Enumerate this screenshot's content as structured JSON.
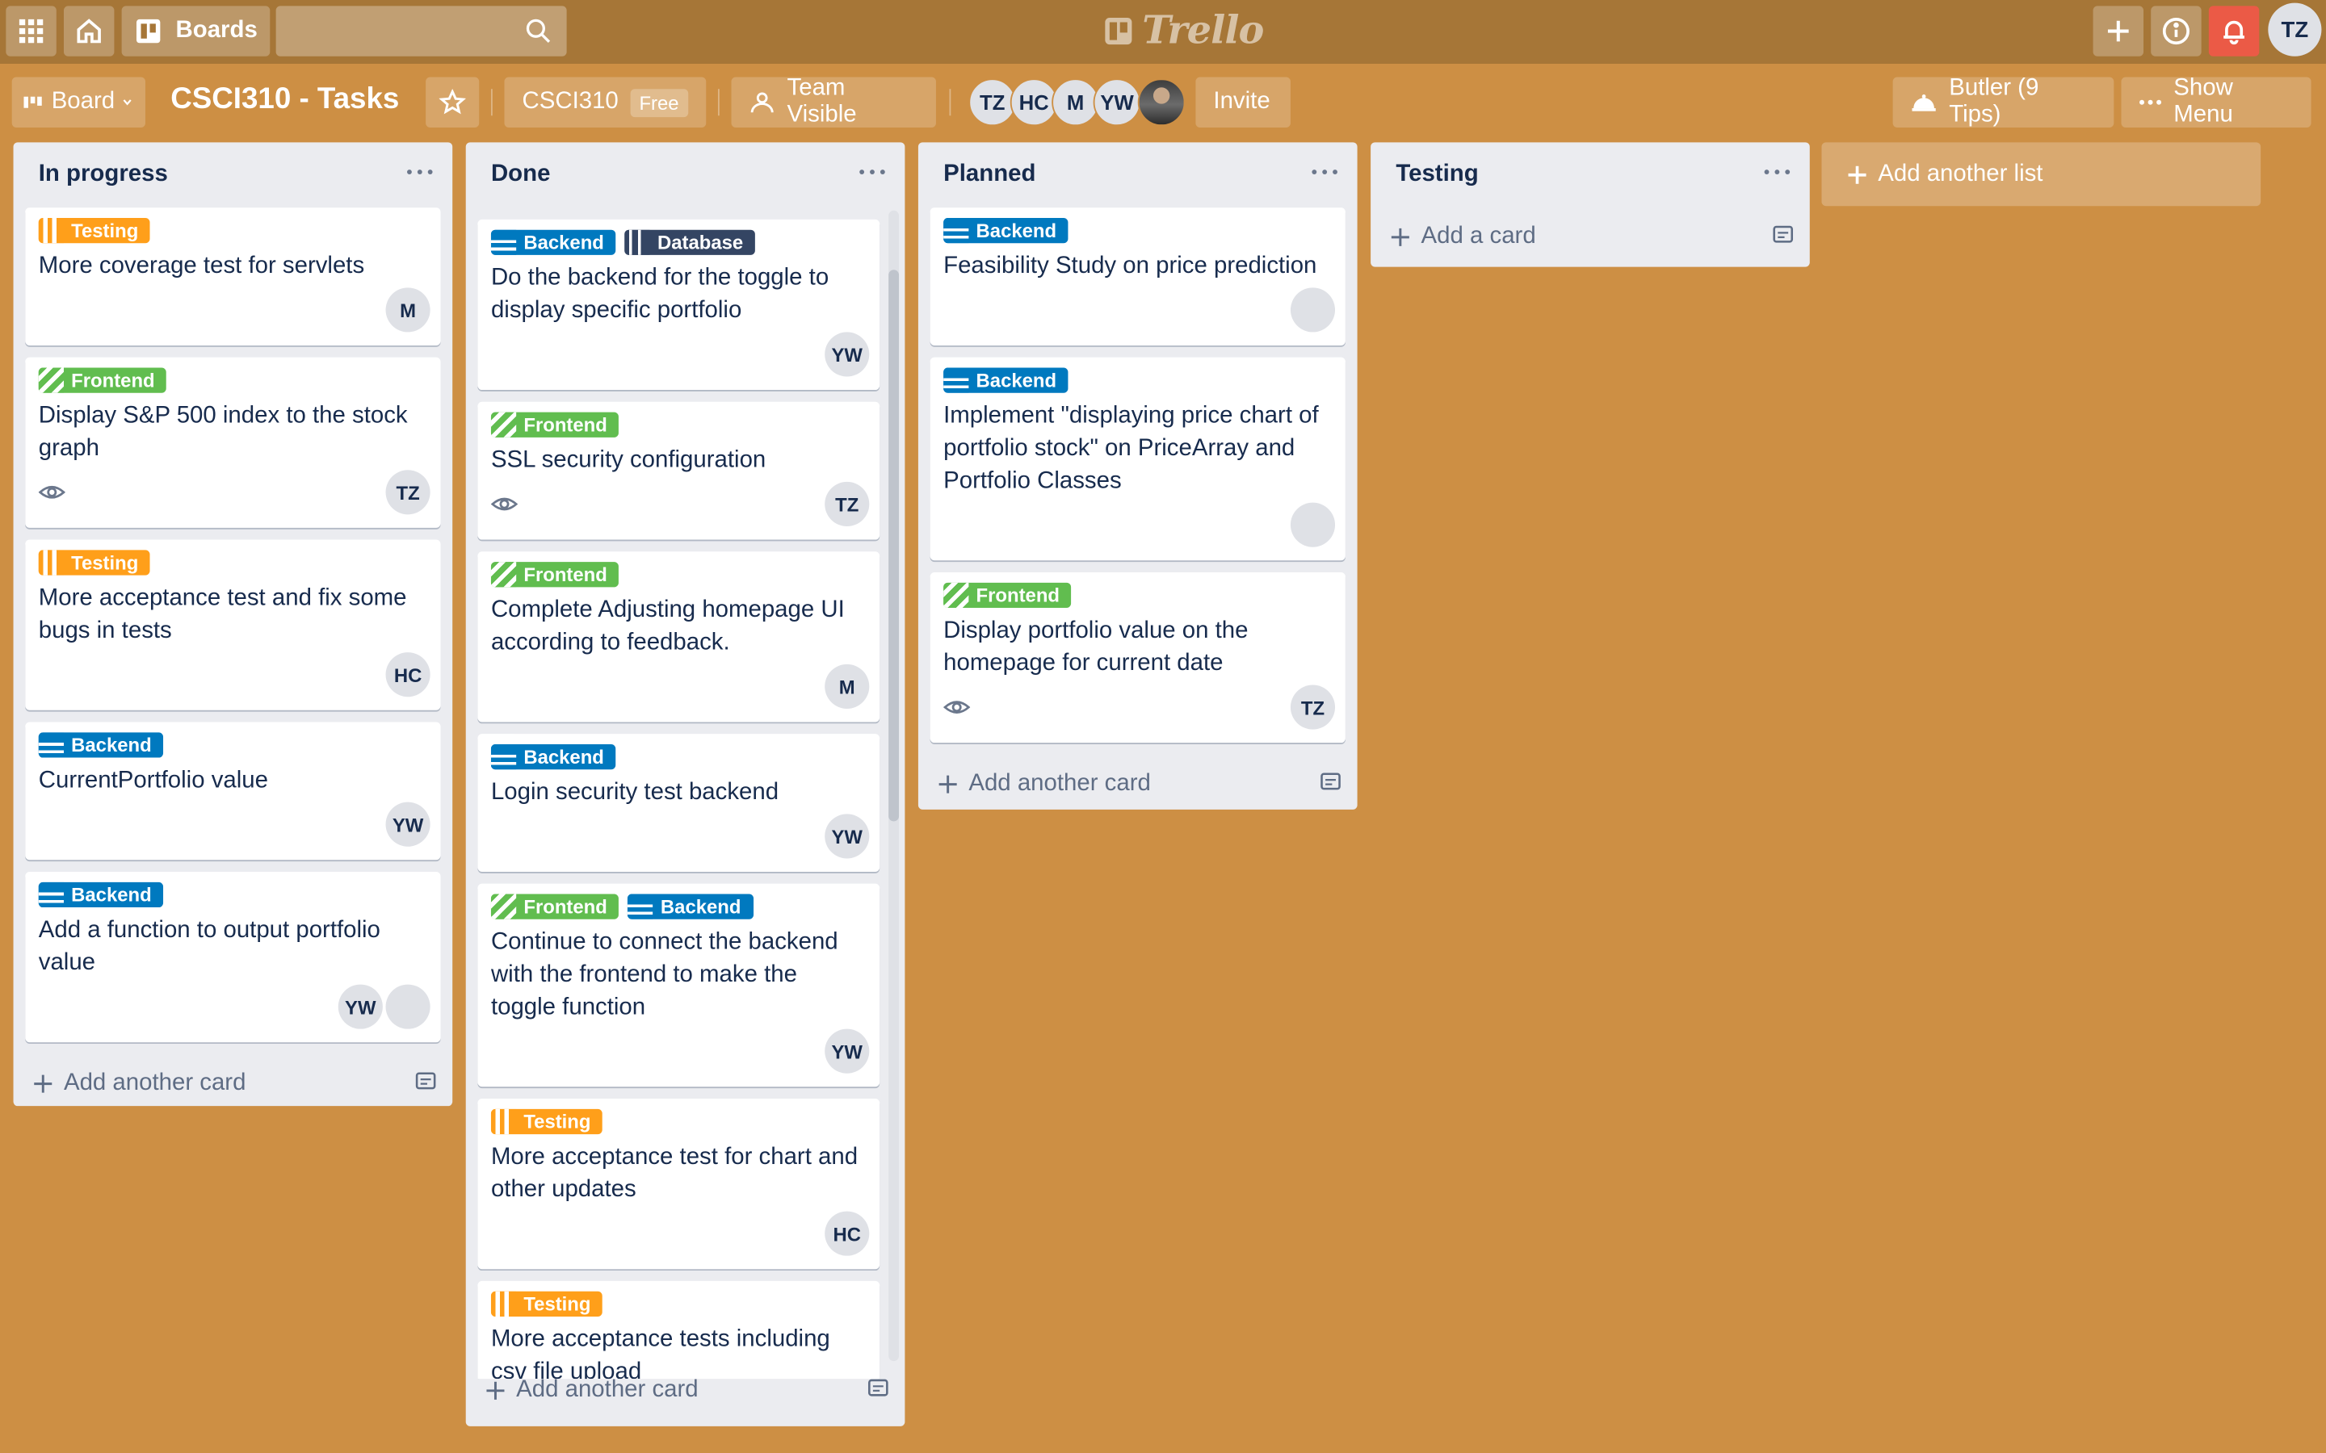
{
  "header": {
    "boards_label": "Boards",
    "logo_text": "Trello",
    "user_initials": "TZ"
  },
  "board": {
    "view_label": "Board",
    "title": "CSCI310 - Tasks",
    "team_name": "CSCI310",
    "team_badge": "Free",
    "visibility_label": "Team Visible",
    "members": [
      "TZ",
      "HC",
      "M",
      "YW"
    ],
    "invite_label": "Invite",
    "butler_label": "Butler (9 Tips)",
    "show_menu_label": "Show Menu"
  },
  "lists": [
    {
      "title": "In progress",
      "add_label": "Add another card",
      "cards": [
        {
          "labels": [
            {
              "name": "Testing",
              "type": "testing"
            }
          ],
          "title": "More coverage test for servlets",
          "watch": false,
          "members": [
            "M"
          ]
        },
        {
          "labels": [
            {
              "name": "Frontend",
              "type": "frontend"
            }
          ],
          "title": "Display S&P 500 index to the stock graph",
          "watch": true,
          "members": [
            "TZ"
          ]
        },
        {
          "labels": [
            {
              "name": "Testing",
              "type": "testing"
            }
          ],
          "title": "More acceptance test and fix some bugs in tests",
          "watch": false,
          "members": [
            "HC"
          ]
        },
        {
          "labels": [
            {
              "name": "Backend",
              "type": "backend"
            }
          ],
          "title": "CurrentPortfolio value",
          "watch": false,
          "members": [
            "YW"
          ]
        },
        {
          "labels": [
            {
              "name": "Backend",
              "type": "backend"
            }
          ],
          "title": "Add a function to output portfolio value",
          "watch": false,
          "members": [
            "YW",
            "photo"
          ]
        }
      ]
    },
    {
      "title": "Done",
      "add_label": "Add another card",
      "cards": [
        {
          "labels": [
            {
              "name": "Backend",
              "type": "backend"
            },
            {
              "name": "Database",
              "type": "database"
            }
          ],
          "title": "Do the backend for the toggle to display specific portfolio",
          "watch": false,
          "members": [
            "YW"
          ]
        },
        {
          "labels": [
            {
              "name": "Frontend",
              "type": "frontend"
            }
          ],
          "title": "SSL security configuration",
          "watch": true,
          "members": [
            "TZ"
          ]
        },
        {
          "labels": [
            {
              "name": "Frontend",
              "type": "frontend"
            }
          ],
          "title": "Complete Adjusting homepage UI according to feedback.",
          "watch": false,
          "members": [
            "M"
          ]
        },
        {
          "labels": [
            {
              "name": "Backend",
              "type": "backend"
            }
          ],
          "title": "Login security test backend",
          "watch": false,
          "members": [
            "YW"
          ]
        },
        {
          "labels": [
            {
              "name": "Frontend",
              "type": "frontend"
            },
            {
              "name": "Backend",
              "type": "backend"
            }
          ],
          "title": "Continue to connect the backend with the frontend to make the toggle function",
          "watch": false,
          "members": [
            "YW"
          ]
        },
        {
          "labels": [
            {
              "name": "Testing",
              "type": "testing"
            }
          ],
          "title": "More acceptance test for chart and other updates",
          "watch": false,
          "members": [
            "HC"
          ]
        },
        {
          "labels": [
            {
              "name": "Testing",
              "type": "testing"
            }
          ],
          "title": "More acceptance tests including csv file upload",
          "watch": false,
          "members": []
        }
      ]
    },
    {
      "title": "Planned",
      "add_label": "Add another card",
      "cards": [
        {
          "labels": [
            {
              "name": "Backend",
              "type": "backend"
            }
          ],
          "title": "Feasibility Study on price prediction",
          "watch": false,
          "members": [
            "photo"
          ]
        },
        {
          "labels": [
            {
              "name": "Backend",
              "type": "backend"
            }
          ],
          "title": "Implement \"displaying price chart of portfolio stock\" on PriceArray and Portfolio Classes",
          "watch": false,
          "members": [
            "photo"
          ]
        },
        {
          "labels": [
            {
              "name": "Frontend",
              "type": "frontend"
            }
          ],
          "title": "Display portfolio value on the homepage for current date",
          "watch": true,
          "members": [
            "TZ"
          ]
        }
      ]
    },
    {
      "title": "Testing",
      "add_label": "Add a card",
      "cards": []
    }
  ],
  "add_list_label": "Add another list",
  "colors": {
    "background": "#cd8f44",
    "testing": "#ff9f1a",
    "frontend": "#61bd4f",
    "backend": "#0079bf",
    "database": "#344563"
  }
}
